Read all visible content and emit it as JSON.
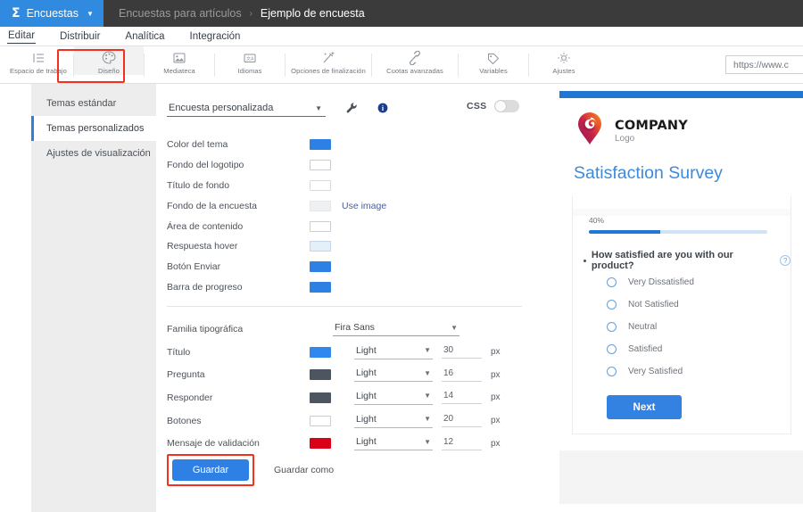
{
  "topbar": {
    "brand_icon": "p-logo-icon",
    "brand_label": "Encuestas",
    "caret_icon": "chevron-down-icon",
    "breadcrumb_parent": "Encuestas para artículos",
    "breadcrumb_separator": "›",
    "breadcrumb_current": "Ejemplo de encuesta"
  },
  "menu": {
    "items": [
      {
        "label": "Editar",
        "active": true
      },
      {
        "label": "Distribuir",
        "active": false
      },
      {
        "label": "Analítica",
        "active": false
      },
      {
        "label": "Integración",
        "active": false
      }
    ]
  },
  "toolbar": {
    "items": [
      {
        "label": "Espacio de trabajo",
        "icon": "workspace-list-icon",
        "selected": false
      },
      {
        "label": "Diseño",
        "icon": "palette-icon",
        "selected": true
      },
      {
        "label": "Mediateca",
        "icon": "image-library-icon",
        "selected": false
      },
      {
        "label": "Idiomas",
        "icon": "languages-icon",
        "selected": false
      },
      {
        "label": "Opciones de finalización",
        "icon": "magic-wand-icon",
        "selected": false
      },
      {
        "label": "Cuotas avanzadas",
        "icon": "chain-link-icon",
        "selected": false
      },
      {
        "label": "Variables",
        "icon": "tag-icon",
        "selected": false
      },
      {
        "label": "Ajustes",
        "icon": "gear-icon",
        "selected": false
      }
    ],
    "url_value": "https://www.c"
  },
  "sidebar": {
    "items": [
      {
        "label": "Temas estándar",
        "active": false
      },
      {
        "label": "Temas personalizados",
        "active": true
      },
      {
        "label": "Ajustes de visualización",
        "active": false
      }
    ]
  },
  "form": {
    "theme_select_value": "Encuesta personalizada",
    "theme_select_caret": "chevron-down-icon",
    "wrench_icon": "wrench-icon",
    "help_icon": "help-info-icon",
    "css_label": "CSS",
    "css_toggle_state": "off",
    "colors": [
      {
        "label": "Color del tema",
        "value": "#2f80e4",
        "border": "#2f80e4"
      },
      {
        "label": "Fondo del logotipo",
        "value": "#ffffff",
        "border": "#c9cdd2"
      },
      {
        "label": "Título de fondo",
        "value": "#ffffff",
        "border": "#d7dbe0"
      },
      {
        "label": "Fondo de la encuesta",
        "value": "#eef0f2",
        "border": "#e4e7ea",
        "extra_link": "Use image"
      },
      {
        "label": "Área de contenido",
        "value": "#ffffff",
        "border": "#c9cdd2"
      },
      {
        "label": "Respuesta hover",
        "value": "#e4eff9",
        "border": "#c4d6e7"
      },
      {
        "label": "Botón Enviar",
        "value": "#2f80e4",
        "border": "#2f80e4"
      },
      {
        "label": "Barra de progreso",
        "value": "#2f80e4",
        "border": "#2f80e4"
      }
    ],
    "font_family_label": "Familia tipográfica",
    "font_family_value": "Fira Sans",
    "typography": [
      {
        "label": "Título",
        "color": "#2f87ef",
        "border": "#2f87ef",
        "weight": "Light",
        "size": "30",
        "unit": "px"
      },
      {
        "label": "Pregunta",
        "color": "#4c5560",
        "border": "#4c5560",
        "weight": "Light",
        "size": "16",
        "unit": "px"
      },
      {
        "label": "Responder",
        "color": "#4c5560",
        "border": "#4c5560",
        "weight": "Light",
        "size": "14",
        "unit": "px"
      },
      {
        "label": "Botones",
        "color": "#ffffff",
        "border": "#c9cdd2",
        "weight": "Light",
        "size": "20",
        "unit": "px"
      },
      {
        "label": "Mensaje de validación",
        "color": "#d90018",
        "border": "#d90018",
        "weight": "Light",
        "size": "12",
        "unit": "px"
      }
    ],
    "save_label": "Guardar",
    "save_as_label": "Guardar como"
  },
  "preview": {
    "company_name": "COMPANY",
    "company_sub": "Logo",
    "logo_icon": "spiral-pin-logo-icon",
    "survey_title": "Satisfaction Survey",
    "progress_label": "40%",
    "progress_value": 40,
    "question": "How satisfied are you with our product?",
    "question_help_icon": "question-mark-icon",
    "options": [
      "Very Dissatisfied",
      "Not Satisfied",
      "Neutral",
      "Satisfied",
      "Very Satisfied"
    ],
    "next_label": "Next"
  },
  "highlights": {
    "accent_red": "#f4301f",
    "accent_blue": "#2f80e4"
  }
}
